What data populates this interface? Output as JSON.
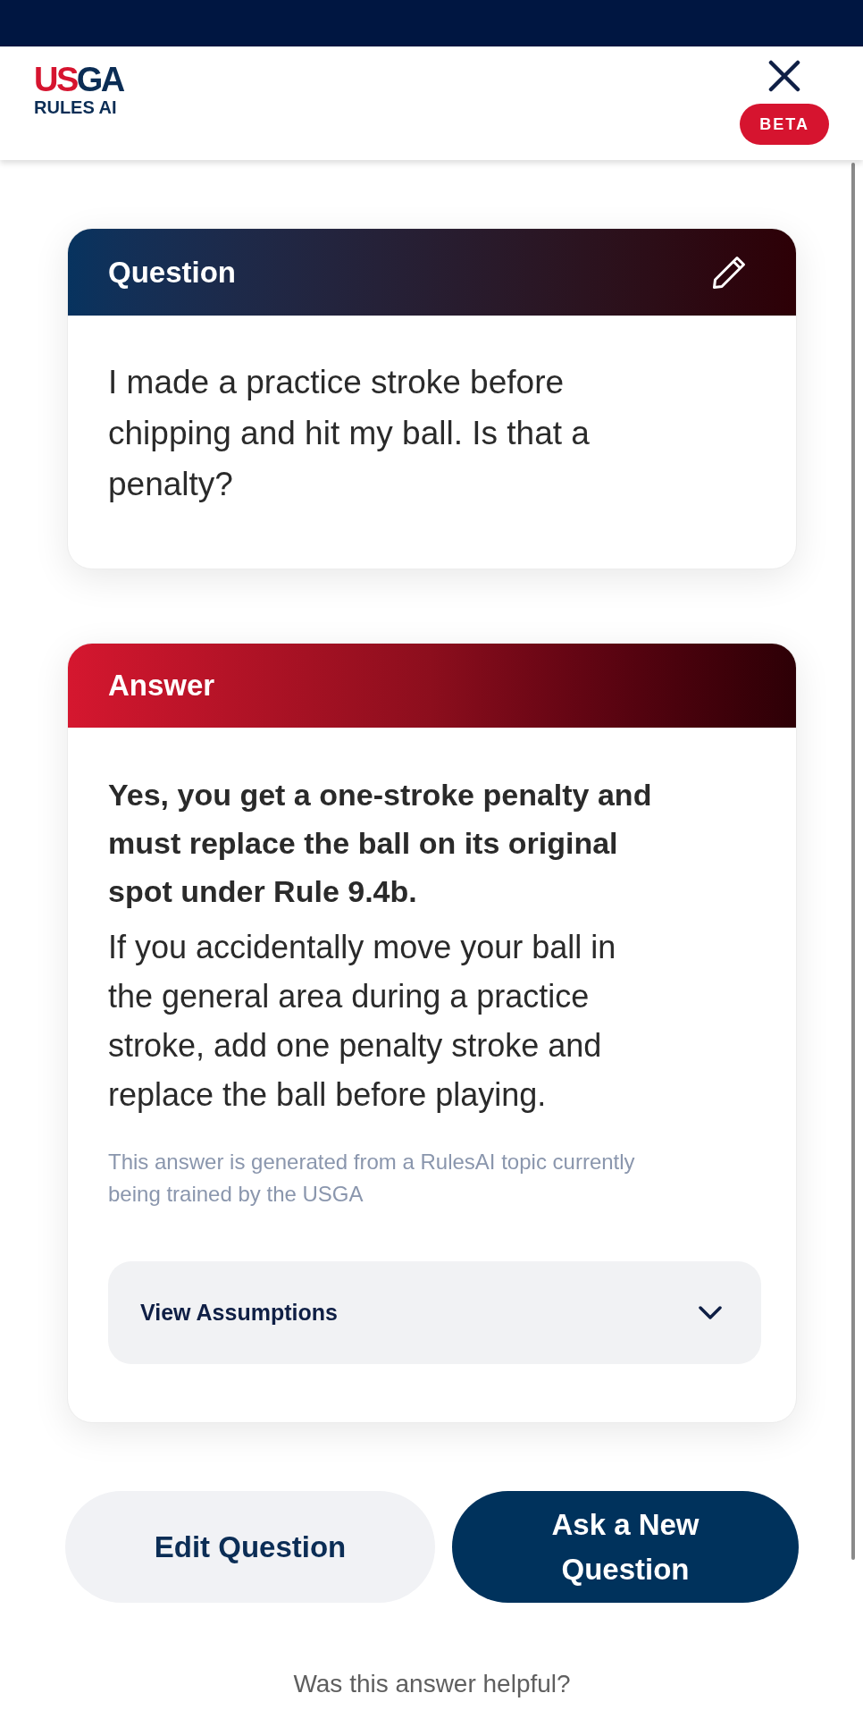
{
  "header": {
    "logo": {
      "wordmark": [
        "US",
        "GA"
      ],
      "subtitle": "RULES AI"
    },
    "badge": "BETA"
  },
  "question_card": {
    "title": "Question",
    "text": "I made a practice stroke before chipping and hit my ball. Is that a penalty?"
  },
  "answer_card": {
    "title": "Answer",
    "summary": "Yes, you get a one-stroke penalty and must replace the ball on its original spot under Rule 9.4b.",
    "explanation": "If you accidentally move your ball in the general area during a practice stroke, add one penalty stroke and replace the ball before playing.",
    "disclaimer": "This answer is generated from a RulesAI topic currently being trained by the USGA",
    "assumptions": {
      "label": "View Assumptions",
      "expanded": false
    }
  },
  "buttons": [
    {
      "label": "Edit Question",
      "kind": "secondary"
    },
    {
      "label": "Ask a New Question",
      "kind": "primary"
    }
  ],
  "feedback": {
    "prompt": "Was this answer helpful?"
  }
}
